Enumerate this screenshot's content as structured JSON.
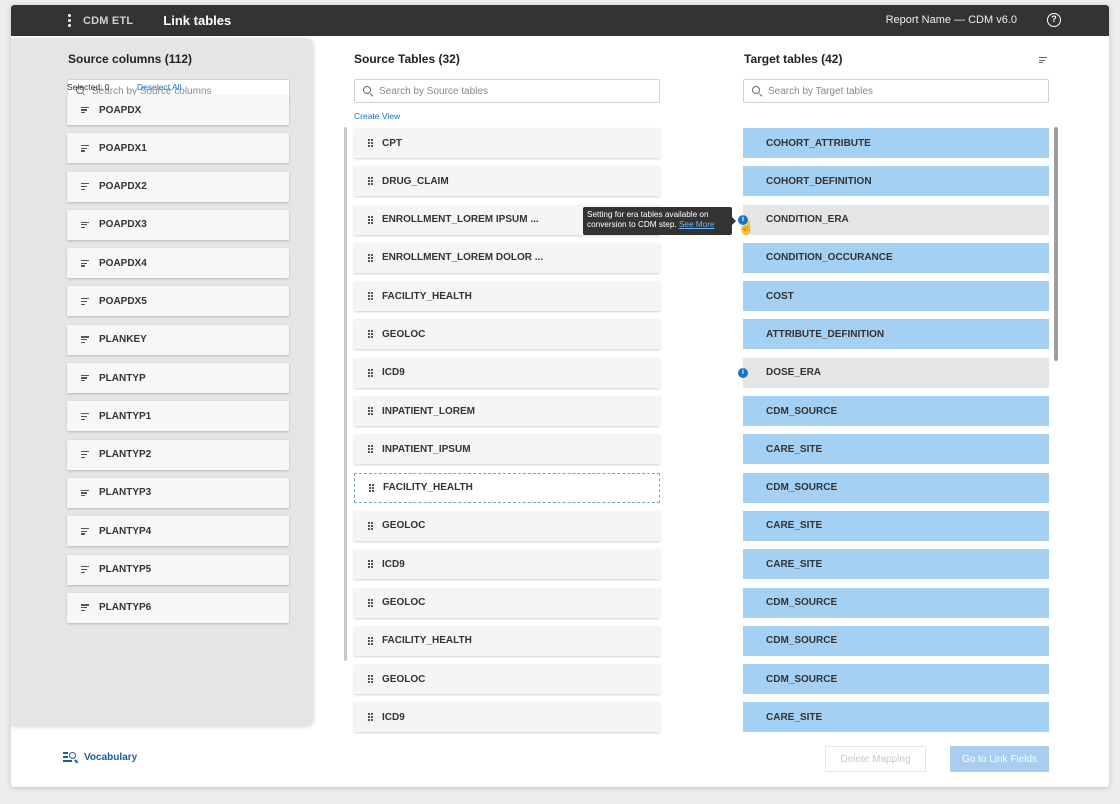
{
  "topbar": {
    "app_name": "CDM ETL",
    "page_title": "Link tables",
    "report_name": "Report Name — CDM v6.0",
    "help_icon": "?"
  },
  "source_columns": {
    "title": "Source columns (112)",
    "search_placeholder": "Search by Source columns",
    "selected_label": "Selected: 0",
    "deselect_all": "Deselect All",
    "items": [
      "POAPDX",
      "POAPDX1",
      "POAPDX2",
      "POAPDX3",
      "POAPDX4",
      "POAPDX5",
      "PLANKEY",
      "PLANTYP",
      "PLANTYP1",
      "PLANTYP2",
      "PLANTYP3",
      "PLANTYP4",
      "PLANTYP5",
      "PLANTYP6"
    ]
  },
  "source_tables": {
    "title": "Source Tables (32)",
    "search_placeholder": "Search by Source tables",
    "create_view": "Create View",
    "items": [
      "CPT",
      "DRUG_CLAIM",
      "ENROLLMENT_LOREM IPSUM ...",
      "ENROLLMENT_LOREM DOLOR ...",
      "FACILITY_HEALTH",
      "GEOLOC",
      "ICD9",
      "INPATIENT_LOREM",
      "INPATIENT_IPSUM",
      "FACILITY_HEALTH",
      "GEOLOC",
      "ICD9",
      "GEOLOC",
      "FACILITY_HEALTH",
      "GEOLOC",
      "ICD9"
    ],
    "active_index": 9
  },
  "target_tables": {
    "title": "Target tables (42)",
    "search_placeholder": "Search by Target tables",
    "items": [
      {
        "label": "COHORT_ATTRIBUTE",
        "state": "linked"
      },
      {
        "label": "COHORT_DEFINITION",
        "state": "linked"
      },
      {
        "label": "CONDITION_ERA",
        "state": "era"
      },
      {
        "label": "CONDITION_OCCURANCE",
        "state": "linked"
      },
      {
        "label": "COST",
        "state": "linked"
      },
      {
        "label": "ATTRIBUTE_DEFINITION",
        "state": "linked"
      },
      {
        "label": "DOSE_ERA",
        "state": "era"
      },
      {
        "label": "CDM_SOURCE",
        "state": "linked"
      },
      {
        "label": "CARE_SITE",
        "state": "linked"
      },
      {
        "label": "CDM_SOURCE",
        "state": "linked"
      },
      {
        "label": "CARE_SITE",
        "state": "linked"
      },
      {
        "label": "CARE_SITE",
        "state": "linked"
      },
      {
        "label": "CDM_SOURCE",
        "state": "linked"
      },
      {
        "label": "CDM_SOURCE",
        "state": "linked"
      },
      {
        "label": "CDM_SOURCE",
        "state": "linked"
      },
      {
        "label": "CARE_SITE",
        "state": "linked"
      }
    ]
  },
  "tooltip": {
    "line1": "Setting for era tables available on",
    "line2": "conversion to CDM step.",
    "link": "See More"
  },
  "footer": {
    "vocabulary": "Vocabulary",
    "delete_mapping": "Delete Mapping",
    "go_to_link_fields": "Go to Link Fields"
  },
  "colors": {
    "topbar": "#333333",
    "linked_target": "#a3d0f3",
    "era_target": "#e5e5e5",
    "accent": "#1a73c8"
  }
}
